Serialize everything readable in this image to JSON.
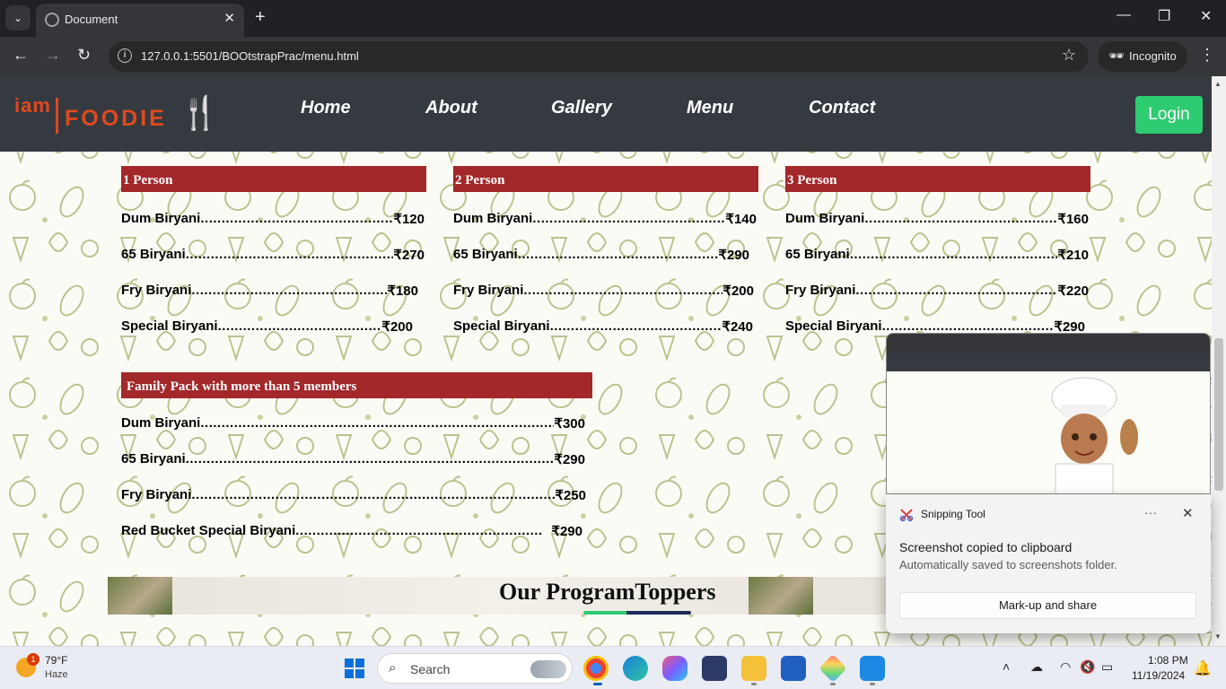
{
  "browser": {
    "tab_title": "Document",
    "url": "127.0.0.1:5501/BOOtstrapPrac/menu.html",
    "incognito_label": "Incognito"
  },
  "site": {
    "logo_iam": "iam",
    "logo_foodie": "FOODIE",
    "nav": [
      "Home",
      "About",
      "Gallery",
      "Menu",
      "Contact"
    ],
    "login_label": "Login"
  },
  "menu": {
    "cards": [
      {
        "header": "1 Person",
        "items": [
          {
            "name": "Dum Biryani",
            "dots": "...................................................",
            "price": "₹120"
          },
          {
            "name": "65 Biryani",
            "dots": "........................................................",
            "price": "₹270"
          },
          {
            "name": "Fry Biryani",
            "dots": ".....................................................",
            "price": "₹180"
          },
          {
            "name": "Special Biryani",
            "dots": "...........................................",
            "price": "₹200"
          }
        ]
      },
      {
        "header": "2 Person",
        "items": [
          {
            "name": "Dum Biryani",
            "dots": "...................................................",
            "price": "₹140"
          },
          {
            "name": "65 Biryani",
            "dots": "........................................................",
            "price": "₹290"
          },
          {
            "name": "Fry Biryani",
            "dots": ".....................................................",
            "price": "₹200"
          },
          {
            "name": "Special Biryani",
            "dots": "...........................................",
            "price": "₹240"
          }
        ]
      },
      {
        "header": "3 Person",
        "items": [
          {
            "name": "Dum Biryani",
            "dots": "...................................................",
            "price": "₹160"
          },
          {
            "name": "65 Biryani",
            "dots": "........................................................",
            "price": "₹210"
          },
          {
            "name": "Fry Biryani",
            "dots": ".....................................................",
            "price": "₹220"
          },
          {
            "name": "Special Biryani",
            "dots": "...........................................",
            "price": "₹290"
          }
        ]
      }
    ],
    "family": {
      "header": "Family Pack with more than 5 members",
      "items": [
        {
          "name": "Dum Biryani",
          "dots": ".....................................................................................",
          "price": "₹300"
        },
        {
          "name": "65 Biryani",
          "dots": "..........................................................................................",
          "price": "₹290"
        },
        {
          "name": "Fry Biryani",
          "dots": "........................................................................................",
          "price": "₹250"
        },
        {
          "name": "Red Bucket Special Biryani",
          "dots": "...........................................................",
          "price": "₹290"
        }
      ]
    },
    "toppers_title": "Our ProgramToppers"
  },
  "snipping": {
    "app_name": "Snipping Tool",
    "title": "Screenshot copied to clipboard",
    "subtitle": "Automatically saved to screenshots folder.",
    "button": "Mark-up and share",
    "more": "···",
    "close": "✕"
  },
  "taskbar": {
    "weather_temp": "79°F",
    "weather_cond": "Haze",
    "weather_badge": "1",
    "search_label": "Search",
    "time": "1:08 PM",
    "date": "11/19/2024"
  },
  "icons": {
    "tab_search": "chevron-down-icon",
    "back": "back-arrow-icon",
    "forward": "forward-arrow-icon",
    "reload": "reload-icon",
    "star": "star-icon",
    "incognito": "incognito-icon",
    "menu": "kebab-menu-icon"
  },
  "colors": {
    "nav_bg": "#343a40",
    "card_header": "#a3282a",
    "login_green": "#2ecc71",
    "logo_orange": "#e0491e"
  }
}
